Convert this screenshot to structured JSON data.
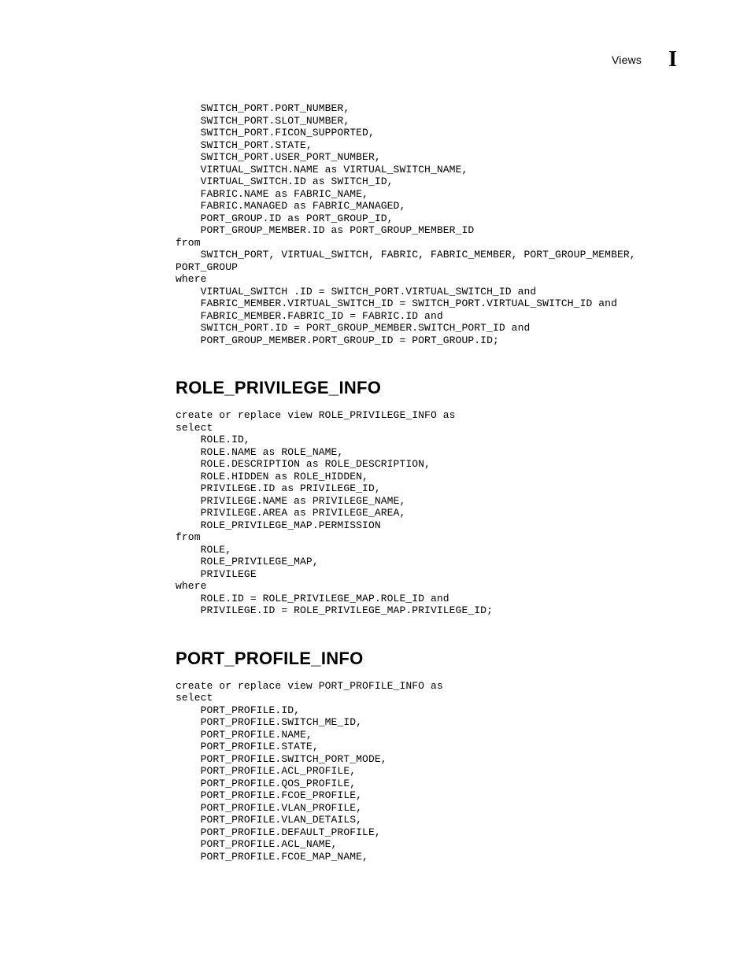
{
  "header": {
    "section_label": "Views",
    "appendix_marker": "I"
  },
  "code_block_1": "    SWITCH_PORT.PORT_NUMBER,\n    SWITCH_PORT.SLOT_NUMBER,\n    SWITCH_PORT.FICON_SUPPORTED,\n    SWITCH_PORT.STATE,\n    SWITCH_PORT.USER_PORT_NUMBER,\n    VIRTUAL_SWITCH.NAME as VIRTUAL_SWITCH_NAME,\n    VIRTUAL_SWITCH.ID as SWITCH_ID,\n    FABRIC.NAME as FABRIC_NAME,\n    FABRIC.MANAGED as FABRIC_MANAGED,\n    PORT_GROUP.ID as PORT_GROUP_ID,\n    PORT_GROUP_MEMBER.ID as PORT_GROUP_MEMBER_ID\nfrom\n    SWITCH_PORT, VIRTUAL_SWITCH, FABRIC, FABRIC_MEMBER, PORT_GROUP_MEMBER, \nPORT_GROUP\nwhere\n    VIRTUAL_SWITCH .ID = SWITCH_PORT.VIRTUAL_SWITCH_ID and\n    FABRIC_MEMBER.VIRTUAL_SWITCH_ID = SWITCH_PORT.VIRTUAL_SWITCH_ID and\n    FABRIC_MEMBER.FABRIC_ID = FABRIC.ID and\n    SWITCH_PORT.ID = PORT_GROUP_MEMBER.SWITCH_PORT_ID and\n    PORT_GROUP_MEMBER.PORT_GROUP_ID = PORT_GROUP.ID;",
  "heading_1": "ROLE_PRIVILEGE_INFO",
  "code_block_2": "create or replace view ROLE_PRIVILEGE_INFO as\nselect\n    ROLE.ID,\n    ROLE.NAME as ROLE_NAME,\n    ROLE.DESCRIPTION as ROLE_DESCRIPTION,\n    ROLE.HIDDEN as ROLE_HIDDEN,\n    PRIVILEGE.ID as PRIVILEGE_ID,\n    PRIVILEGE.NAME as PRIVILEGE_NAME,\n    PRIVILEGE.AREA as PRIVILEGE_AREA,\n    ROLE_PRIVILEGE_MAP.PERMISSION\nfrom\n    ROLE,\n    ROLE_PRIVILEGE_MAP,\n    PRIVILEGE\nwhere\n    ROLE.ID = ROLE_PRIVILEGE_MAP.ROLE_ID and\n    PRIVILEGE.ID = ROLE_PRIVILEGE_MAP.PRIVILEGE_ID;",
  "heading_2": "PORT_PROFILE_INFO",
  "code_block_3": "create or replace view PORT_PROFILE_INFO as\nselect\n    PORT_PROFILE.ID,\n    PORT_PROFILE.SWITCH_ME_ID,\n    PORT_PROFILE.NAME,\n    PORT_PROFILE.STATE,\n    PORT_PROFILE.SWITCH_PORT_MODE,\n    PORT_PROFILE.ACL_PROFILE,\n    PORT_PROFILE.QOS_PROFILE,\n    PORT_PROFILE.FCOE_PROFILE,\n    PORT_PROFILE.VLAN_PROFILE,\n    PORT_PROFILE.VLAN_DETAILS,\n    PORT_PROFILE.DEFAULT_PROFILE,\n    PORT_PROFILE.ACL_NAME,\n    PORT_PROFILE.FCOE_MAP_NAME,"
}
